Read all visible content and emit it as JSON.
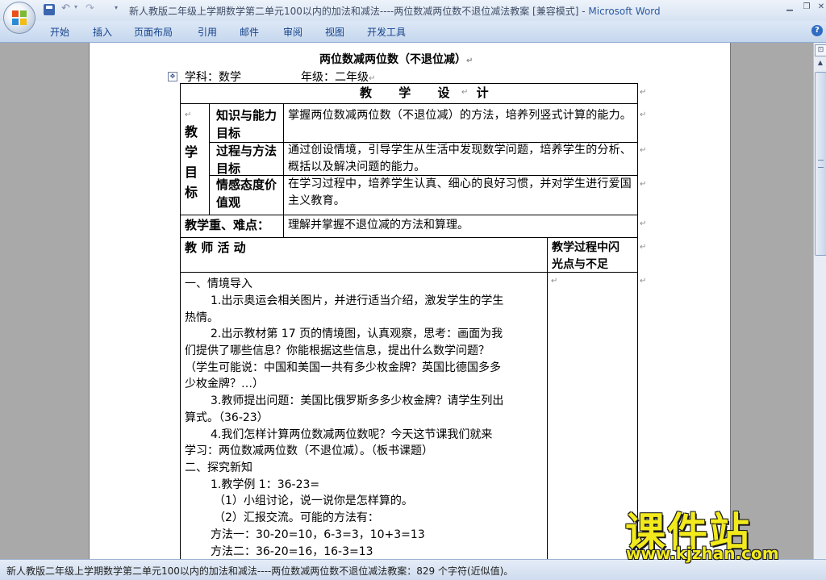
{
  "window": {
    "title": "新人教版二年级上学期数学第二单元100以内的加法和减法----两位数减两位数不退位减法教案 [兼容模式] - ",
    "app_name": "Microsoft Word",
    "min_glyph": "▁",
    "restore_glyph": "❐",
    "close_glyph": "✕"
  },
  "quick_access": {
    "undo_glyph": "↶",
    "dropdown_glyph": "▾",
    "redo_glyph": "↷",
    "more_glyph": "▾"
  },
  "ribbon": {
    "tabs": [
      "开始",
      "插入",
      "页面布局",
      "引用",
      "邮件",
      "审阅",
      "视图",
      "开发工具"
    ],
    "help_glyph": "?"
  },
  "scrollbar": {
    "ruler_glyph": "⊡",
    "up_glyph": "▲"
  },
  "document": {
    "title": "两位数减两位数（不退位减）",
    "subject": "学科：数学",
    "grade": "年级：二年级",
    "table": {
      "design_header": "教 学 设 计",
      "goal_label": "教学目标",
      "rows": [
        {
          "label": "知识与能力目标",
          "text": "掌握两位数减两位数（不退位减）的方法，培养列竖式计算的能力。"
        },
        {
          "label": "过程与方法目标",
          "text": "通过创设情境，引导学生从生活中发现数学问题，培养学生的分析、概括以及解决问题的能力。"
        },
        {
          "label": "情感态度价值观",
          "text": "在学习过程中，培养学生认真、细心的良好习惯，并对学生进行爱国主义教育。"
        }
      ],
      "key_label": "教学重、难点：",
      "key_text": "理解并掌握不退位减的方法和算理。",
      "teacher_header": "教 师 活 动",
      "reflect_header_1": "教学过程中闪",
      "reflect_header_2": "光点与不足"
    },
    "body": [
      "一、情境导入",
      "1.出示奥运会相关图片，并进行适当介绍，激发学生的学生",
      "热情。",
      "2.出示教材第 17 页的情境图，认真观察，思考：画面为我",
      "们提供了哪些信息？你能根据这些信息，提出什么数学问题？",
      "（学生可能说：中国和美国一共有多少枚金牌？英国比德国多多",
      "少枚金牌？…）",
      "3.教师提出问题：美国比俄罗斯多多少枚金牌？请学生列出",
      "算式。（36-23）",
      "4.我们怎样计算两位数减两位数呢？今天这节课我们就来",
      "学习：两位数减两位数（不退位减）。（板书课题）",
      "二、探究新知",
      "1.教学例 1：36-23=",
      "（1）小组讨论，说一说你是怎样算的。",
      "（2）汇报交流。可能的方法有：",
      "方法一：30-20=10，6-3=3，10+3=13",
      "方法二：36-20=16，16-3=13"
    ],
    "paragraph_mark": "↵",
    "move_handle_glyph": "✥"
  },
  "status_bar": {
    "text": "新人教版二年级上学期数学第二单元100以内的加法和减法----两位数减两位数不退位减法教案：829 个字符(近似值)。"
  },
  "watermark": {
    "main": "课件站",
    "url": "www.kjzhan.com"
  }
}
